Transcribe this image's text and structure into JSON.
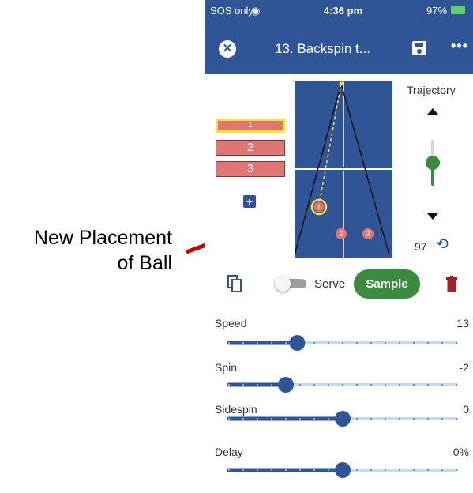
{
  "annotation": {
    "line1": "New Placement",
    "line2": "of Ball"
  },
  "status_bar": {
    "carrier": "SOS only",
    "time": "4:36 pm",
    "battery": "97%"
  },
  "app_bar": {
    "title": "13. Backspin t...",
    "close_icon": "close-circle-icon",
    "save_icon": "floppy-save-icon",
    "more_icon": "more-dots-icon",
    "more_text": "•••"
  },
  "placements": [
    {
      "label": "1",
      "selected": true
    },
    {
      "label": "2",
      "selected": false
    },
    {
      "label": "3",
      "selected": false
    }
  ],
  "add_label": "+",
  "table": {
    "balls": [
      {
        "label": "1",
        "selected": true
      },
      {
        "label": "2",
        "selected": false
      },
      {
        "label": "3",
        "selected": false
      }
    ]
  },
  "trajectory": {
    "label": "Trajectory",
    "value": "97",
    "level": 0.5
  },
  "actions": {
    "serve_label": "Serve",
    "serve_on": false,
    "sample_label": "Sample"
  },
  "sliders": [
    {
      "name": "speed",
      "label": "Speed",
      "value": "13",
      "position": 0.3
    },
    {
      "name": "spin",
      "label": "Spin",
      "value": "-2",
      "position": 0.25
    },
    {
      "name": "sidespin",
      "label": "Sidespin",
      "value": "0",
      "position": 0.5
    },
    {
      "name": "delay",
      "label": "Delay",
      "value": "0%",
      "position": 0.5
    }
  ],
  "colors": {
    "header": "#2f5597",
    "table": "#2f5597",
    "chip": "#e07674",
    "selection": "#f8e132",
    "sample_button": "#3a8b3f",
    "delete": "#a52222",
    "slider_fill": "#2f5597",
    "slider_track": "#c6dbf2",
    "arrow": "#c00000"
  }
}
